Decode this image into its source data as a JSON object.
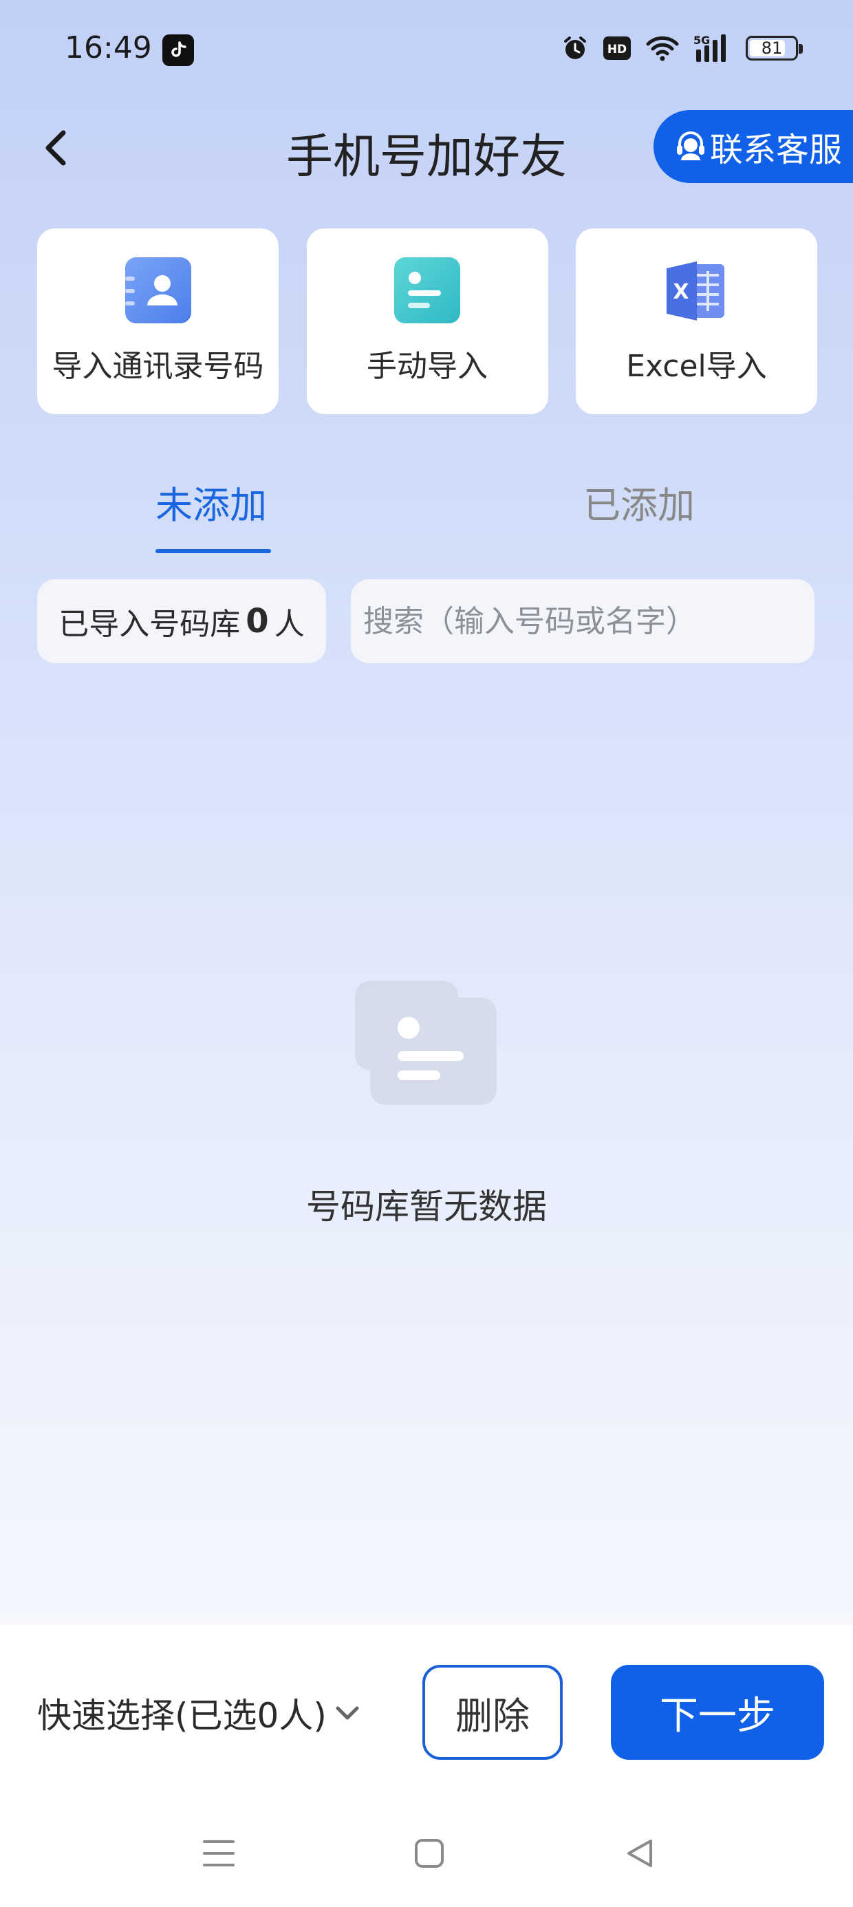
{
  "status_bar": {
    "time": "16:49",
    "hd_label": "HD",
    "network_label": "5G",
    "battery_level": "81",
    "icons": [
      "tiktok-icon",
      "alarm-icon",
      "hd-icon",
      "wifi-icon",
      "signal-icon",
      "battery-icon"
    ]
  },
  "header": {
    "back_icon": "chevron-left-icon",
    "title": "手机号加好友",
    "contact_button_label": "联系客服",
    "contact_icon": "headset-icon"
  },
  "import_options": [
    {
      "label": "导入通讯录号码",
      "icon": "contact-card-icon"
    },
    {
      "label": "手动导入",
      "icon": "document-list-icon"
    },
    {
      "label": "Excel导入",
      "icon": "excel-icon"
    }
  ],
  "tabs": [
    {
      "label": "未添加",
      "active": true
    },
    {
      "label": "已添加",
      "active": false
    }
  ],
  "count": {
    "prefix": "已导入号码库",
    "value": "0",
    "suffix": "人"
  },
  "search": {
    "placeholder": "搜索（输入号码或名字）",
    "value": ""
  },
  "empty_state": {
    "icon": "empty-contacts-icon",
    "text": "号码库暂无数据"
  },
  "bottom_bar": {
    "quick_select_label": "快速选择(已选0人)",
    "delete_label": "删除",
    "next_label": "下一步"
  },
  "nav_bar": {
    "icons": [
      "menu-icon",
      "home-icon",
      "back-triangle-icon"
    ]
  },
  "colors": {
    "accent": "#1060e8",
    "tab_active": "#1a66e0",
    "tab_inactive": "#888888",
    "card_bg": "#ffffff",
    "input_bg": "#f3f5fa"
  }
}
